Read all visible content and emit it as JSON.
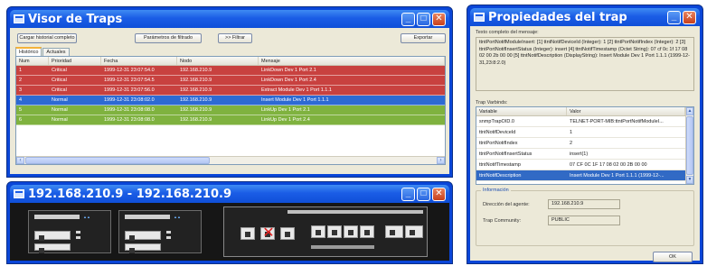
{
  "traps_window": {
    "title": "Visor de Traps",
    "buttons": {
      "load_history": "Cargar historial completo",
      "filter_params": "Parámetros de filtrado",
      "filter": ">> Filtrar",
      "export": "Exportar"
    },
    "tabs": [
      "Histórico",
      "Actuales"
    ],
    "columns": [
      "Num",
      "Prioridad",
      "Fecha",
      "Nodo",
      "Mensaje"
    ],
    "rows": [
      {
        "num": "1",
        "priority": "Critical",
        "date": "1999-12-31 23:07:54.0",
        "node": "192.168.210.9",
        "message": "LinkDown Dev 1 Port 2.1",
        "color": "#c8413f"
      },
      {
        "num": "2",
        "priority": "Critical",
        "date": "1999-12-31 23:07:54.5",
        "node": "192.168.210.9",
        "message": "LinkDown Dev 1 Port 2.4",
        "color": "#c8413f"
      },
      {
        "num": "3",
        "priority": "Critical",
        "date": "1999-12-31 23:07:56.0",
        "node": "192.168.210.9",
        "message": "Extract Module Dev 1 Port 1.1.1",
        "color": "#c8413f"
      },
      {
        "num": "4",
        "priority": "Normal",
        "date": "1999-12-31 23:08:02.0",
        "node": "192.168.210.9",
        "message": "Insert Module Dev 1 Port 1.1.1",
        "color": "#2d6ad3"
      },
      {
        "num": "5",
        "priority": "Normal",
        "date": "1999-12-31 23:08:08.0",
        "node": "192.168.210.9",
        "message": "LinkUp Dev 1 Port 2.1",
        "color": "#7fb23f"
      },
      {
        "num": "6",
        "priority": "Normal",
        "date": "1999-12-31 23:08:08.0",
        "node": "192.168.210.9",
        "message": "LinkUp Dev 1 Port 2.4",
        "color": "#7fb23f"
      }
    ]
  },
  "device_window": {
    "title": "192.168.210.9 - 192.168.210.9"
  },
  "props_window": {
    "title": "Propiedades del trap",
    "full_text_label": "Texto completo del mensaje:",
    "full_text": "ttntPortNotifModuleInsert: [1] ttntNotifDeviceId (Integer): 1 [2] ttntPortNotifIndex (Integer): 2 [3] ttntPortNotifInsertStatus (Integer): insert [4] ttntNotifTimestamp (Octet String): 07 cf 0c 1f 17 08 02 00 2b 00 00 [5] ttntNotifDescription (DisplayString): Insert Module Dev 1 Port 1.1.1 (1999-12-31,23:8:2.0)",
    "varbinds_label": "Trap Varbinds:",
    "varbind_columns": [
      "Variable",
      "Valor"
    ],
    "varbinds": [
      {
        "variable": "snmpTrapOID.0",
        "value": "TELNET-PORT-MIB:ttntPortNotifModuleI...",
        "selected": false
      },
      {
        "variable": "ttntNotifDeviceId",
        "value": "1",
        "selected": false
      },
      {
        "variable": "ttntPortNotifIndex",
        "value": "2",
        "selected": false
      },
      {
        "variable": "ttntPortNotifInsertStatus",
        "value": "insert(1)",
        "selected": false
      },
      {
        "variable": "ttntNotifTimestamp",
        "value": "07 CF 0C 1F 17 08 02 00 2B 00 00",
        "selected": false
      },
      {
        "variable": "ttntNotifDescription",
        "value": "Insert Module Dev 1 Port 1.1.1 (1999-12-...",
        "selected": true
      }
    ],
    "info_label": "Información",
    "agent_label": "Dirección del agente:",
    "agent_value": "192.168.210.9",
    "community_label": "Trap Community:",
    "community_value": "PUBLIC",
    "ok_label": "OK"
  },
  "colors": {
    "xp_blue": "#0a46d8",
    "critical": "#c8413f",
    "normal_selected": "#2d6ad3",
    "normal": "#7fb23f"
  }
}
